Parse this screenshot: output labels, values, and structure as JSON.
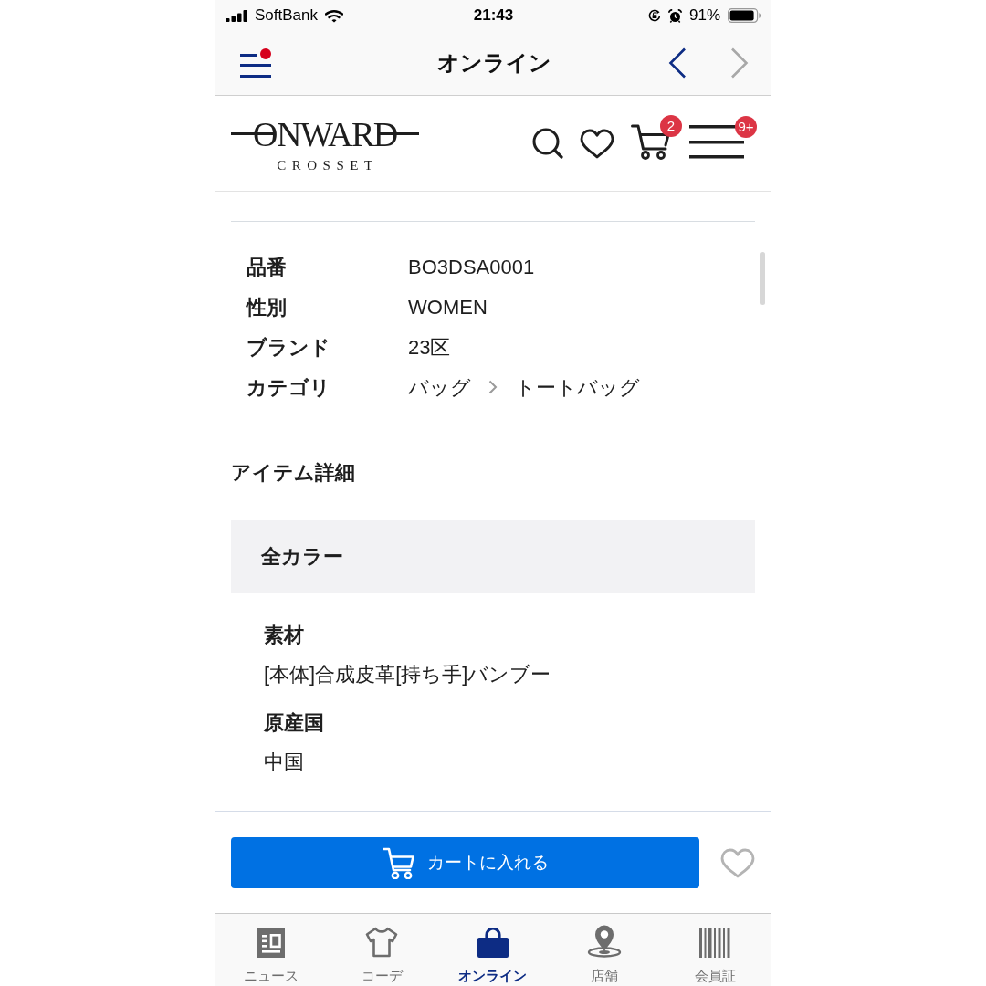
{
  "status_bar": {
    "carrier": "SoftBank",
    "time": "21:43",
    "battery": "91%"
  },
  "nav_bar": {
    "title": "オンライン",
    "menu_notification": true,
    "back_disabled": false,
    "forward_disabled": true
  },
  "site_header": {
    "logo": "ONWARD",
    "logo_subtitle": "CROSSET",
    "cart_badge": "2",
    "menu_badge": "9+"
  },
  "specs": [
    {
      "kind": "text",
      "label": "品番",
      "value": "BO3DSA0001"
    },
    {
      "kind": "text",
      "label": "性別",
      "value": "WOMEN"
    },
    {
      "kind": "text",
      "label": "ブランド",
      "value": "23区"
    },
    {
      "kind": "path",
      "label": "カテゴリ",
      "path": [
        "バッグ",
        "トートバッグ"
      ]
    }
  ],
  "item_details": {
    "title": "アイテム詳細",
    "panel_title": "全カラー",
    "fields": [
      {
        "label": "素材",
        "value": "[本体]合成皮革[持ち手]バンブー"
      },
      {
        "label": "原産国",
        "value": "中国"
      }
    ]
  },
  "action_bar": {
    "add_to_cart": "カートに入れる",
    "favorite": false
  },
  "tab_bar": [
    {
      "label": "ニュース",
      "selected": false
    },
    {
      "label": "コーデ",
      "selected": false
    },
    {
      "label": "オンライン",
      "selected": true
    },
    {
      "label": "店舗",
      "selected": false
    },
    {
      "label": "会員証",
      "selected": false
    }
  ]
}
